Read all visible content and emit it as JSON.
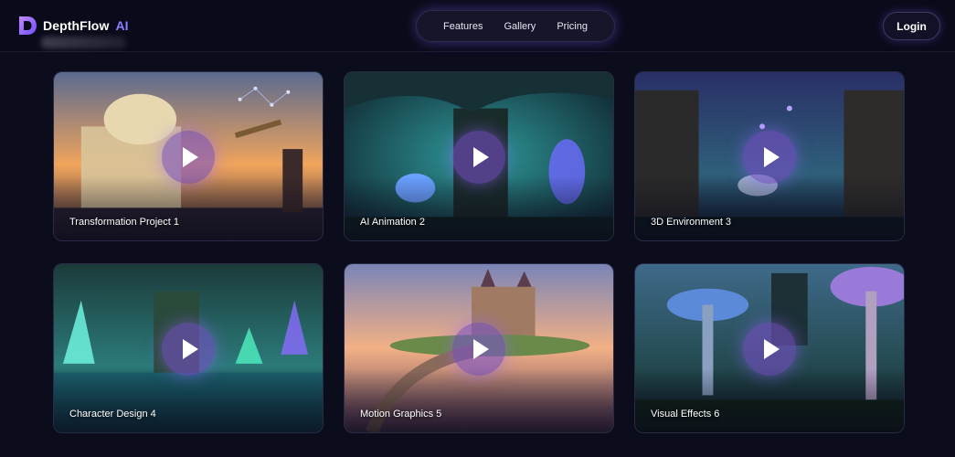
{
  "brand": {
    "name": "DepthFlow",
    "suffix": "AI",
    "logo_icon": "depthflow-d-logo-icon",
    "accent": "#8b7dff"
  },
  "nav": {
    "items": [
      "Features",
      "Gallery",
      "Pricing"
    ]
  },
  "header": {
    "login_label": "Login"
  },
  "gallery": {
    "play_icon": "play-icon",
    "cards": [
      {
        "title": "Transformation Project 1",
        "theme": [
          "#f0a45c",
          "#6a4f73",
          "#2a2438"
        ]
      },
      {
        "title": "AI Animation 2",
        "theme": [
          "#2f9a9a",
          "#1a4b5c",
          "#0f2433"
        ]
      },
      {
        "title": "3D Environment 3",
        "theme": [
          "#6e63c7",
          "#2a3466",
          "#141a36"
        ]
      },
      {
        "title": "Character Design 4",
        "theme": [
          "#2fa39a",
          "#1e4a5a",
          "#101d2c"
        ]
      },
      {
        "title": "Motion Graphics 5",
        "theme": [
          "#f2b085",
          "#9b6a8c",
          "#4a3550"
        ]
      },
      {
        "title": "Visual Effects 6",
        "theme": [
          "#5a7fc0",
          "#2a4a5a",
          "#0f1e2a"
        ]
      }
    ]
  }
}
